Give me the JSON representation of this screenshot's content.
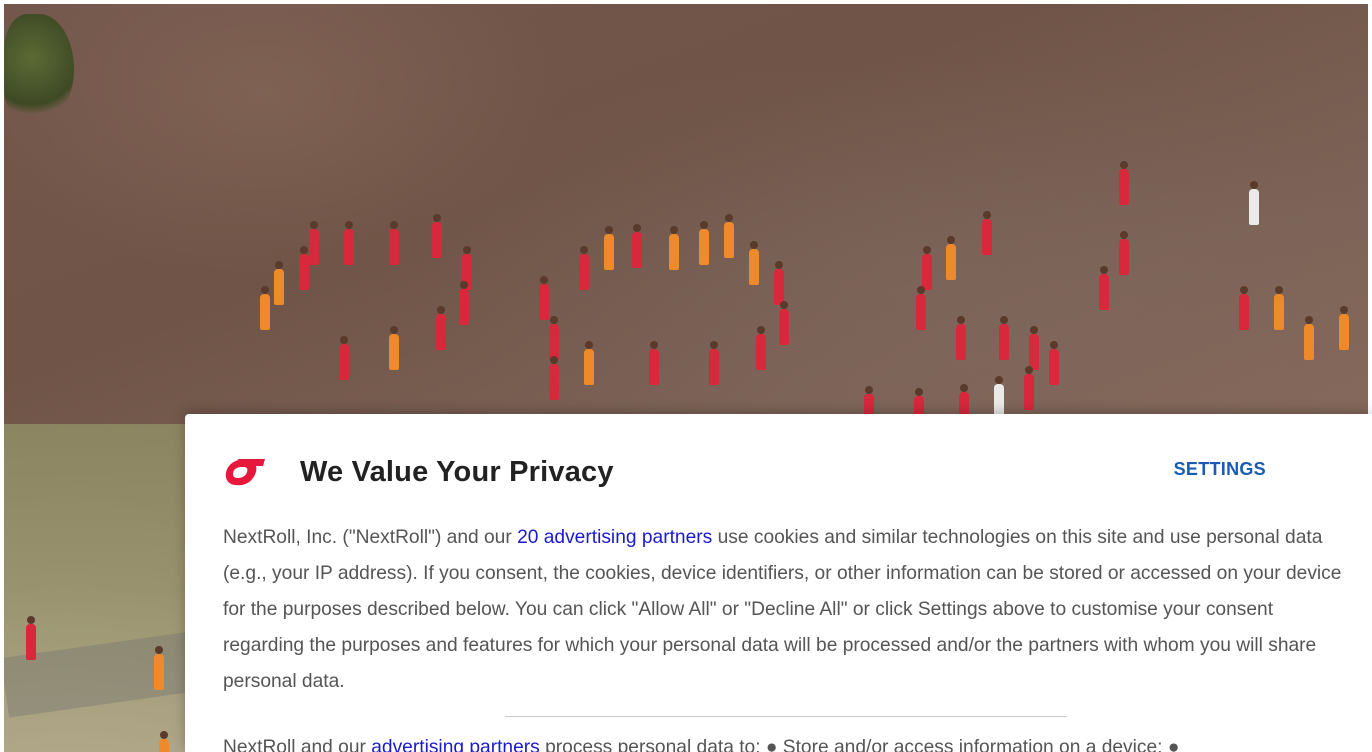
{
  "background": {
    "description_icon": "aerial-photo-image"
  },
  "dialog": {
    "logo_icon": "nextroll-logo-icon",
    "brand_color": "#e8183c",
    "title": "We Value Your Privacy",
    "settings_label": "SETTINGS",
    "link_color": "#1a1ad0",
    "paragraph1": {
      "before_link": "NextRoll, Inc. (\"NextRoll\") and our ",
      "link": "20 advertising partners",
      "after_link": " use cookies and similar technologies on this site and use personal data (e.g., your IP address). If you consent, the cookies, device identifiers, or other information can be stored or accessed on your device for the purposes described below. You can click \"Allow All\" or \"Decline All\" or click Settings above to customise your consent regarding the purposes and features for which your personal data will be processed and/or the partners with whom you will share personal data."
    },
    "paragraph2": {
      "before_link": "NextRoll and our ",
      "link": "advertising partners",
      "after_link": " process personal data to: ● Store and/or access information on a device; ●"
    }
  }
}
